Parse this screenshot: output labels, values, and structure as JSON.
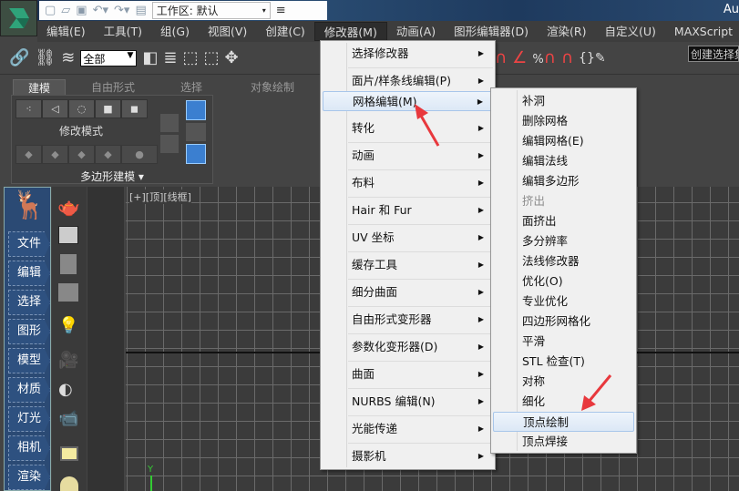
{
  "titlebar": {
    "workspace_label": "工作区: 默认",
    "app_name": "Au"
  },
  "menubar": [
    "编辑(E)",
    "工具(T)",
    "组(G)",
    "视图(V)",
    "创建(C)",
    "修改器(M)",
    "动画(A)",
    "图形编辑器(D)",
    "渲染(R)",
    "自定义(U)",
    "MAXScript"
  ],
  "active_menu": "修改器(M)",
  "toolbar": {
    "selection_filter": "全部",
    "named_selection": "创建选择集",
    "snap_labels": [
      "3",
      "%"
    ]
  },
  "ribbon": {
    "tabs": [
      "建模",
      "自由形式",
      "选择",
      "对象绘制"
    ],
    "panel_title": "修改模式",
    "footer": "多边形建模 ▾"
  },
  "viewport": {
    "label": "[+][顶][线框]",
    "axis": "Y"
  },
  "left_panel": [
    "文件",
    "编辑",
    "选择",
    "图形",
    "模型",
    "材质",
    "灯光",
    "相机",
    "渲染"
  ],
  "modifier_menu": [
    {
      "label": "选择修改器",
      "submenu": true
    },
    {
      "label": "面片/样条线编辑(P)",
      "submenu": true
    },
    {
      "label": "网格编辑(M)",
      "submenu": true,
      "highlighted": true
    },
    {
      "label": "转化",
      "submenu": true
    },
    {
      "label": "动画",
      "submenu": true
    },
    {
      "label": "布料",
      "submenu": true
    },
    {
      "label": "Hair 和 Fur",
      "submenu": true
    },
    {
      "label": "UV 坐标",
      "submenu": true
    },
    {
      "label": "缓存工具",
      "submenu": true
    },
    {
      "label": "细分曲面",
      "submenu": true
    },
    {
      "label": "自由形式变形器",
      "submenu": true
    },
    {
      "label": "参数化变形器(D)",
      "submenu": true
    },
    {
      "label": "曲面",
      "submenu": true
    },
    {
      "label": "NURBS 编辑(N)",
      "submenu": true
    },
    {
      "label": "光能传递",
      "submenu": true
    },
    {
      "label": "摄影机",
      "submenu": true
    }
  ],
  "mesh_edit_submenu": [
    {
      "label": "补洞"
    },
    {
      "label": "删除网格"
    },
    {
      "label": "编辑网格(E)"
    },
    {
      "label": "编辑法线"
    },
    {
      "label": "编辑多边形"
    },
    {
      "label": "挤出",
      "disabled": true
    },
    {
      "label": "面挤出"
    },
    {
      "label": "多分辨率"
    },
    {
      "label": "法线修改器"
    },
    {
      "label": "优化(O)"
    },
    {
      "label": "专业优化"
    },
    {
      "label": "四边形网格化"
    },
    {
      "label": "平滑"
    },
    {
      "label": "STL 检查(T)"
    },
    {
      "label": "对称"
    },
    {
      "label": "细化"
    },
    {
      "label": "顶点绘制",
      "highlighted": true
    },
    {
      "label": "顶点焊接"
    }
  ],
  "colors": {
    "highlight": "#dce8f6",
    "annotation_arrow": "#e8383d",
    "left_panel": "#2b4a74"
  }
}
